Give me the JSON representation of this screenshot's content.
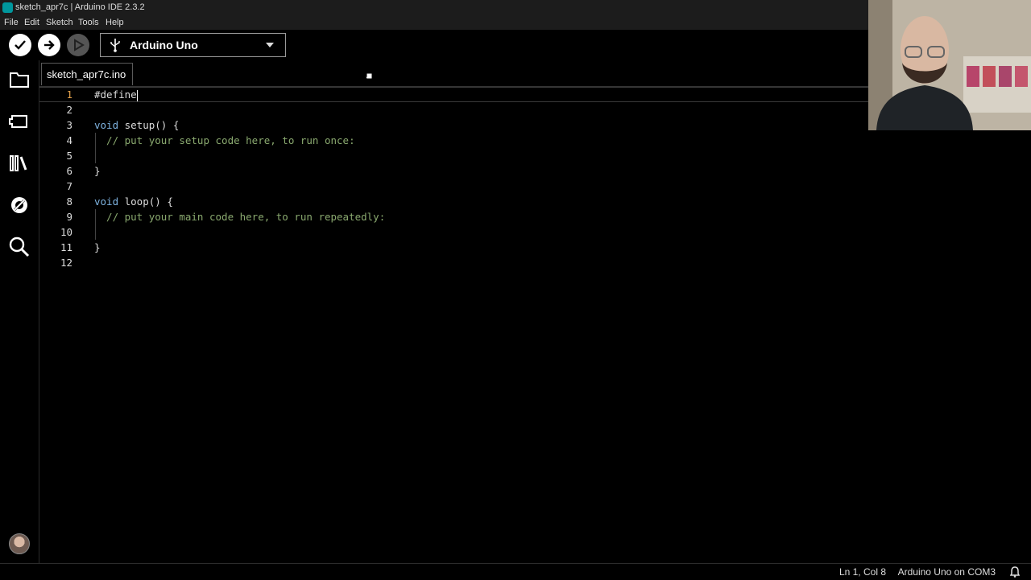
{
  "window": {
    "title": "sketch_apr7c | Arduino IDE 2.3.2"
  },
  "menu": [
    "File",
    "Edit",
    "Sketch",
    "Tools",
    "Help"
  ],
  "toolbar": {
    "board": "Arduino Uno"
  },
  "tabs": [
    {
      "label": "sketch_apr7c.ino"
    }
  ],
  "editor": {
    "line_numbers": [
      "1",
      "2",
      "3",
      "4",
      "5",
      "6",
      "7",
      "8",
      "9",
      "10",
      "11",
      "12"
    ],
    "lines": [
      "#define",
      "",
      "void setup() {",
      "  // put your setup code here, to run once:",
      "",
      "}",
      "",
      "void loop() {",
      "  // put your main code here, to run repeatedly:",
      "",
      "}",
      ""
    ],
    "active_line": 1
  },
  "status": {
    "cursor_position": "Ln 1, Col 8",
    "board_port": "Arduino Uno on COM3"
  },
  "colors": {
    "accent": "#00979d",
    "keyword": "#7eb3e0",
    "comment": "#8aa96f",
    "current_line_number": "#e2a04b"
  },
  "icons": {
    "verify": "check-icon",
    "upload": "arrow-right-icon",
    "debug": "debug-play-icon",
    "sidebar": [
      "folder-icon",
      "board-manager-icon",
      "library-icon",
      "debug-no-icon",
      "search-icon"
    ]
  }
}
